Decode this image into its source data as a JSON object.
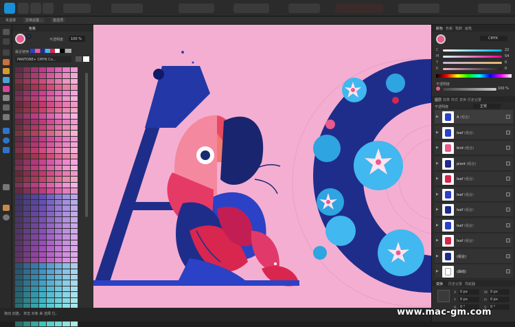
{
  "context_bar": {
    "item1": "未选择",
    "item2": "文档设置...",
    "item3": "首选项"
  },
  "left_panel": {
    "tab": "色板",
    "opacity_label": "不透明度",
    "opacity_value": "100 %",
    "recent_label": "最近使用",
    "palette_name": "PANTONE+ CMYK Co..."
  },
  "right_panel": {
    "tabs": [
      "颜色",
      "色板",
      "笔刷",
      "画笔"
    ],
    "mode": "CMYK",
    "channels": [
      {
        "label": "C",
        "value": "22"
      },
      {
        "label": "M",
        "value": "54"
      },
      {
        "label": "Y",
        "value": "0"
      },
      {
        "label": "K",
        "value": "0"
      }
    ],
    "opacity_label": "不透明度",
    "opacity_value": "100 %",
    "layers_tabs": [
      "图层",
      "效果",
      "样式",
      "变换",
      "历史记录"
    ],
    "blend_label": "不透明度",
    "blend_mode": "正常",
    "layers": [
      {
        "name": "A",
        "suffix": "(组合)"
      },
      {
        "name": "leaf",
        "suffix": "(组合)"
      },
      {
        "name": "bird",
        "suffix": "(组合)"
      },
      {
        "name": "plant",
        "suffix": "(组合)"
      },
      {
        "name": "leaf",
        "suffix": "(组合)"
      },
      {
        "name": "leaf",
        "suffix": "(组合)"
      },
      {
        "name": "leaf",
        "suffix": "(组合)"
      },
      {
        "name": "leaf",
        "suffix": "(组合)"
      },
      {
        "name": "leaf",
        "suffix": "(组合)"
      },
      {
        "name": "(组合)",
        "suffix": ""
      },
      {
        "name": "(曲线)",
        "suffix": ""
      }
    ],
    "transform_tabs": [
      "变换",
      "历史记录",
      "导航器"
    ],
    "fields": [
      {
        "label": "X",
        "value": "0 px"
      },
      {
        "label": "W",
        "value": "0 px"
      },
      {
        "label": "Y",
        "value": "0 px"
      },
      {
        "label": "H",
        "value": "0 px"
      },
      {
        "label": "R",
        "value": "0 °"
      },
      {
        "label": "S",
        "value": "0 °"
      }
    ]
  },
  "status": "拖动 创建， 单击 对象 来 选择 它。",
  "watermark": "www.mac-gm.com",
  "colors": {
    "canvas": "#f4aed1",
    "navy": "#1f2d8a",
    "blue": "#2b41c6",
    "cyan": "#41b8ef",
    "pink": "#e95a8e",
    "red": "#d8264e"
  }
}
